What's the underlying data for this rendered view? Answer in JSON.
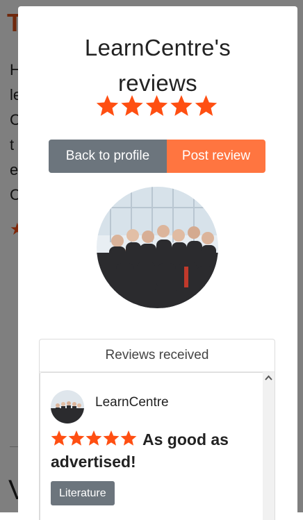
{
  "background": {
    "title_fragment": "T",
    "text_fragments": [
      "H",
      "le",
      "C",
      "t",
      "e",
      "C"
    ],
    "star_glyph": "★",
    "big_fragment": "V"
  },
  "modal": {
    "title_line1": "LearnCentre's",
    "title_line2": "reviews",
    "rating": 5,
    "rating_max": 5,
    "buttons": {
      "back_label": "Back to profile",
      "post_label": "Post review"
    },
    "reviews_section": {
      "header": "Reviews received",
      "reviews": [
        {
          "reviewer_name": "LearnCentre",
          "rating": 5,
          "heading": "As good as advertised!",
          "tag": "Literature"
        }
      ]
    }
  },
  "colors": {
    "star": "#ff4f12",
    "accent": "#ff7540",
    "secondary": "#6c757d",
    "overlay": "rgba(0,0,0,0.5)"
  },
  "icons": {
    "star": "star-icon",
    "scroll_up": "chevron-up-icon"
  }
}
